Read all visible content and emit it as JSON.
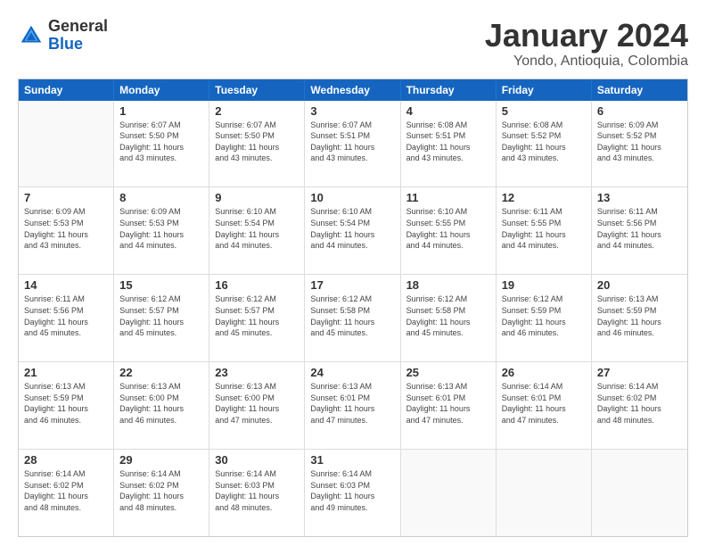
{
  "header": {
    "logo_general": "General",
    "logo_blue": "Blue",
    "month_year": "January 2024",
    "location": "Yondo, Antioquia, Colombia"
  },
  "days_of_week": [
    "Sunday",
    "Monday",
    "Tuesday",
    "Wednesday",
    "Thursday",
    "Friday",
    "Saturday"
  ],
  "rows": [
    [
      {
        "day": "",
        "info": ""
      },
      {
        "day": "1",
        "info": "Sunrise: 6:07 AM\nSunset: 5:50 PM\nDaylight: 11 hours\nand 43 minutes."
      },
      {
        "day": "2",
        "info": "Sunrise: 6:07 AM\nSunset: 5:50 PM\nDaylight: 11 hours\nand 43 minutes."
      },
      {
        "day": "3",
        "info": "Sunrise: 6:07 AM\nSunset: 5:51 PM\nDaylight: 11 hours\nand 43 minutes."
      },
      {
        "day": "4",
        "info": "Sunrise: 6:08 AM\nSunset: 5:51 PM\nDaylight: 11 hours\nand 43 minutes."
      },
      {
        "day": "5",
        "info": "Sunrise: 6:08 AM\nSunset: 5:52 PM\nDaylight: 11 hours\nand 43 minutes."
      },
      {
        "day": "6",
        "info": "Sunrise: 6:09 AM\nSunset: 5:52 PM\nDaylight: 11 hours\nand 43 minutes."
      }
    ],
    [
      {
        "day": "7",
        "info": "Sunrise: 6:09 AM\nSunset: 5:53 PM\nDaylight: 11 hours\nand 43 minutes."
      },
      {
        "day": "8",
        "info": "Sunrise: 6:09 AM\nSunset: 5:53 PM\nDaylight: 11 hours\nand 44 minutes."
      },
      {
        "day": "9",
        "info": "Sunrise: 6:10 AM\nSunset: 5:54 PM\nDaylight: 11 hours\nand 44 minutes."
      },
      {
        "day": "10",
        "info": "Sunrise: 6:10 AM\nSunset: 5:54 PM\nDaylight: 11 hours\nand 44 minutes."
      },
      {
        "day": "11",
        "info": "Sunrise: 6:10 AM\nSunset: 5:55 PM\nDaylight: 11 hours\nand 44 minutes."
      },
      {
        "day": "12",
        "info": "Sunrise: 6:11 AM\nSunset: 5:55 PM\nDaylight: 11 hours\nand 44 minutes."
      },
      {
        "day": "13",
        "info": "Sunrise: 6:11 AM\nSunset: 5:56 PM\nDaylight: 11 hours\nand 44 minutes."
      }
    ],
    [
      {
        "day": "14",
        "info": "Sunrise: 6:11 AM\nSunset: 5:56 PM\nDaylight: 11 hours\nand 45 minutes."
      },
      {
        "day": "15",
        "info": "Sunrise: 6:12 AM\nSunset: 5:57 PM\nDaylight: 11 hours\nand 45 minutes."
      },
      {
        "day": "16",
        "info": "Sunrise: 6:12 AM\nSunset: 5:57 PM\nDaylight: 11 hours\nand 45 minutes."
      },
      {
        "day": "17",
        "info": "Sunrise: 6:12 AM\nSunset: 5:58 PM\nDaylight: 11 hours\nand 45 minutes."
      },
      {
        "day": "18",
        "info": "Sunrise: 6:12 AM\nSunset: 5:58 PM\nDaylight: 11 hours\nand 45 minutes."
      },
      {
        "day": "19",
        "info": "Sunrise: 6:12 AM\nSunset: 5:59 PM\nDaylight: 11 hours\nand 46 minutes."
      },
      {
        "day": "20",
        "info": "Sunrise: 6:13 AM\nSunset: 5:59 PM\nDaylight: 11 hours\nand 46 minutes."
      }
    ],
    [
      {
        "day": "21",
        "info": "Sunrise: 6:13 AM\nSunset: 5:59 PM\nDaylight: 11 hours\nand 46 minutes."
      },
      {
        "day": "22",
        "info": "Sunrise: 6:13 AM\nSunset: 6:00 PM\nDaylight: 11 hours\nand 46 minutes."
      },
      {
        "day": "23",
        "info": "Sunrise: 6:13 AM\nSunset: 6:00 PM\nDaylight: 11 hours\nand 47 minutes."
      },
      {
        "day": "24",
        "info": "Sunrise: 6:13 AM\nSunset: 6:01 PM\nDaylight: 11 hours\nand 47 minutes."
      },
      {
        "day": "25",
        "info": "Sunrise: 6:13 AM\nSunset: 6:01 PM\nDaylight: 11 hours\nand 47 minutes."
      },
      {
        "day": "26",
        "info": "Sunrise: 6:14 AM\nSunset: 6:01 PM\nDaylight: 11 hours\nand 47 minutes."
      },
      {
        "day": "27",
        "info": "Sunrise: 6:14 AM\nSunset: 6:02 PM\nDaylight: 11 hours\nand 48 minutes."
      }
    ],
    [
      {
        "day": "28",
        "info": "Sunrise: 6:14 AM\nSunset: 6:02 PM\nDaylight: 11 hours\nand 48 minutes."
      },
      {
        "day": "29",
        "info": "Sunrise: 6:14 AM\nSunset: 6:02 PM\nDaylight: 11 hours\nand 48 minutes."
      },
      {
        "day": "30",
        "info": "Sunrise: 6:14 AM\nSunset: 6:03 PM\nDaylight: 11 hours\nand 48 minutes."
      },
      {
        "day": "31",
        "info": "Sunrise: 6:14 AM\nSunset: 6:03 PM\nDaylight: 11 hours\nand 49 minutes."
      },
      {
        "day": "",
        "info": ""
      },
      {
        "day": "",
        "info": ""
      },
      {
        "day": "",
        "info": ""
      }
    ]
  ]
}
